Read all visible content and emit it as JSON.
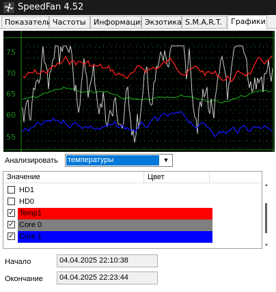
{
  "window": {
    "title": "SpeedFan 4.52",
    "icon": "speedfan-app-icon"
  },
  "tabs": [
    {
      "label": "Показатели",
      "active": false
    },
    {
      "label": "Частоты",
      "active": false
    },
    {
      "label": "Информация",
      "active": false
    },
    {
      "label": "Экзотика",
      "active": false
    },
    {
      "label": "S.M.A.R.T.",
      "active": false
    },
    {
      "label": "Графики",
      "active": true
    }
  ],
  "chart": {
    "y_ticks": [
      "75",
      "70",
      "65",
      "60",
      "55"
    ],
    "background": "#000000",
    "grid_color": "#1e8c1e",
    "series_colors": {
      "Temp1": "#ff2020",
      "Core 0": "#9a9a9a",
      "Core 1": "#1010ff"
    }
  },
  "analyze": {
    "label": "Анализировать",
    "selected": "температуры"
  },
  "list": {
    "headers": [
      "Значение",
      "Цвет"
    ],
    "rows": [
      {
        "label": "HD1",
        "checked": false,
        "color": "#ffffff",
        "text_color": "#000000"
      },
      {
        "label": "HD0",
        "checked": false,
        "color": "#ffffff",
        "text_color": "#000000"
      },
      {
        "label": "Temp1",
        "checked": true,
        "color": "#ff0000",
        "text_color": "#000000"
      },
      {
        "label": "Core 0",
        "checked": true,
        "color": "#808080",
        "text_color": "#000000"
      },
      {
        "label": "Core 1",
        "checked": true,
        "color": "#0000ff",
        "text_color": "#000000"
      }
    ]
  },
  "times": {
    "start_label": "Начало",
    "start_value": "04.04.2025 22:10:38",
    "end_label": "Окончание",
    "end_value": "04.04.2025 22:23:44"
  }
}
